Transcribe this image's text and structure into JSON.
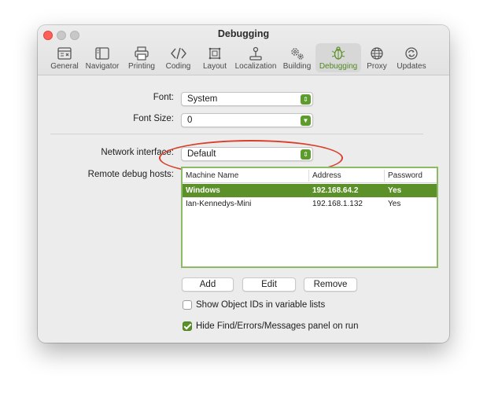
{
  "window": {
    "title": "Debugging"
  },
  "toolbar": {
    "items": [
      {
        "label": "General",
        "icon": "general-icon"
      },
      {
        "label": "Navigator",
        "icon": "navigator-icon"
      },
      {
        "label": "Printing",
        "icon": "printer-icon"
      },
      {
        "label": "Coding",
        "icon": "code-icon"
      },
      {
        "label": "Layout",
        "icon": "layout-icon"
      },
      {
        "label": "Localization",
        "icon": "joystick-icon"
      },
      {
        "label": "Building",
        "icon": "gears-icon"
      },
      {
        "label": "Debugging",
        "icon": "bug-icon",
        "active": true
      },
      {
        "label": "Proxy",
        "icon": "globe-icon"
      },
      {
        "label": "Updates",
        "icon": "refresh-icon"
      }
    ]
  },
  "settings": {
    "font_label": "Font:",
    "font_value": "System",
    "font_size_label": "Font Size:",
    "font_size_value": "0",
    "network_label": "Network interface:",
    "network_value": "Default",
    "remote_hosts_label": "Remote debug hosts:"
  },
  "hosts_table": {
    "columns": [
      "Machine Name",
      "Address",
      "Password"
    ],
    "rows": [
      [
        "Windows",
        "192.168.64.2",
        "Yes"
      ],
      [
        "Ian-Kennedys-Mini",
        "192.168.1.132",
        "Yes"
      ]
    ],
    "selected_row": 0
  },
  "buttons": {
    "add": "Add",
    "edit": "Edit",
    "remove": "Remove"
  },
  "checkboxes": {
    "show_object_ids": {
      "label": "Show Object IDs in variable lists",
      "checked": false
    },
    "hide_panel": {
      "label": "Hide Find/Errors/Messages panel on run",
      "checked": true
    }
  },
  "colors": {
    "accent": "#5b9128",
    "annotation": "#d8402a",
    "close_button": "#ff5f57"
  }
}
